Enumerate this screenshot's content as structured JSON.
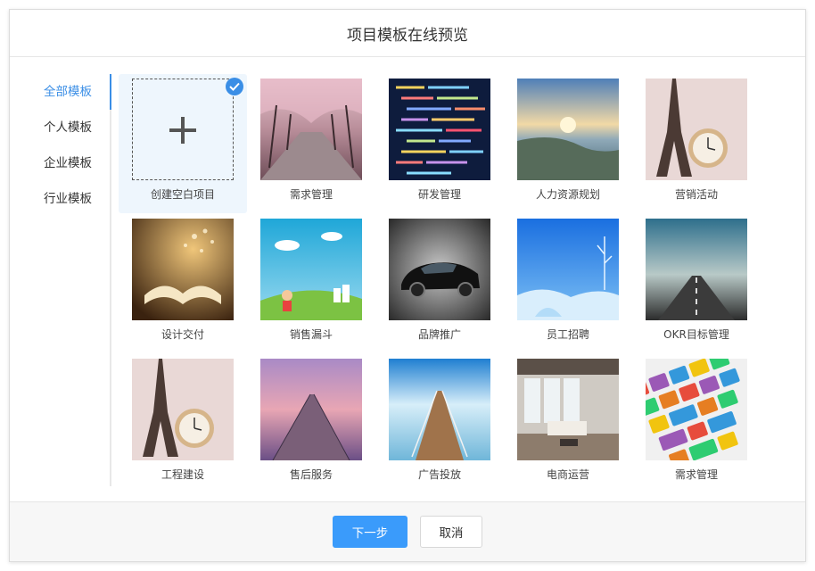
{
  "header": {
    "title": "项目模板在线预览"
  },
  "sidebar": {
    "items": [
      {
        "label": "全部模板",
        "active": true
      },
      {
        "label": "个人模板",
        "active": false
      },
      {
        "label": "企业模板",
        "active": false
      },
      {
        "label": "行业模板",
        "active": false
      }
    ]
  },
  "templates": [
    {
      "label": "创建空白项目",
      "icon": "plus-icon",
      "selected": true
    },
    {
      "label": "需求管理",
      "image": "cherry-blossom-road"
    },
    {
      "label": "研发管理",
      "image": "code-screen"
    },
    {
      "label": "人力资源规划",
      "image": "aerial-sunset-lake"
    },
    {
      "label": "营销活动",
      "image": "eiffel-tower-clock"
    },
    {
      "label": "设计交付",
      "image": "open-book-dandelion"
    },
    {
      "label": "销售漏斗",
      "image": "cartoon-children-meadow"
    },
    {
      "label": "品牌推广",
      "image": "black-sports-car"
    },
    {
      "label": "员工招聘",
      "image": "blue-winter-landscape"
    },
    {
      "label": "OKR目标管理",
      "image": "road-to-horizon"
    },
    {
      "label": "工程建设",
      "image": "eiffel-tower-clock"
    },
    {
      "label": "售后服务",
      "image": "pier-at-dusk"
    },
    {
      "label": "广告投放",
      "image": "wooden-pier-sea"
    },
    {
      "label": "电商运营",
      "image": "modern-living-room"
    },
    {
      "label": "需求管理",
      "image": "colorful-keyboard"
    }
  ],
  "footer": {
    "next_label": "下一步",
    "cancel_label": "取消"
  },
  "colors": {
    "accent": "#3a8ee6",
    "primary_button": "#3a9bfb"
  }
}
